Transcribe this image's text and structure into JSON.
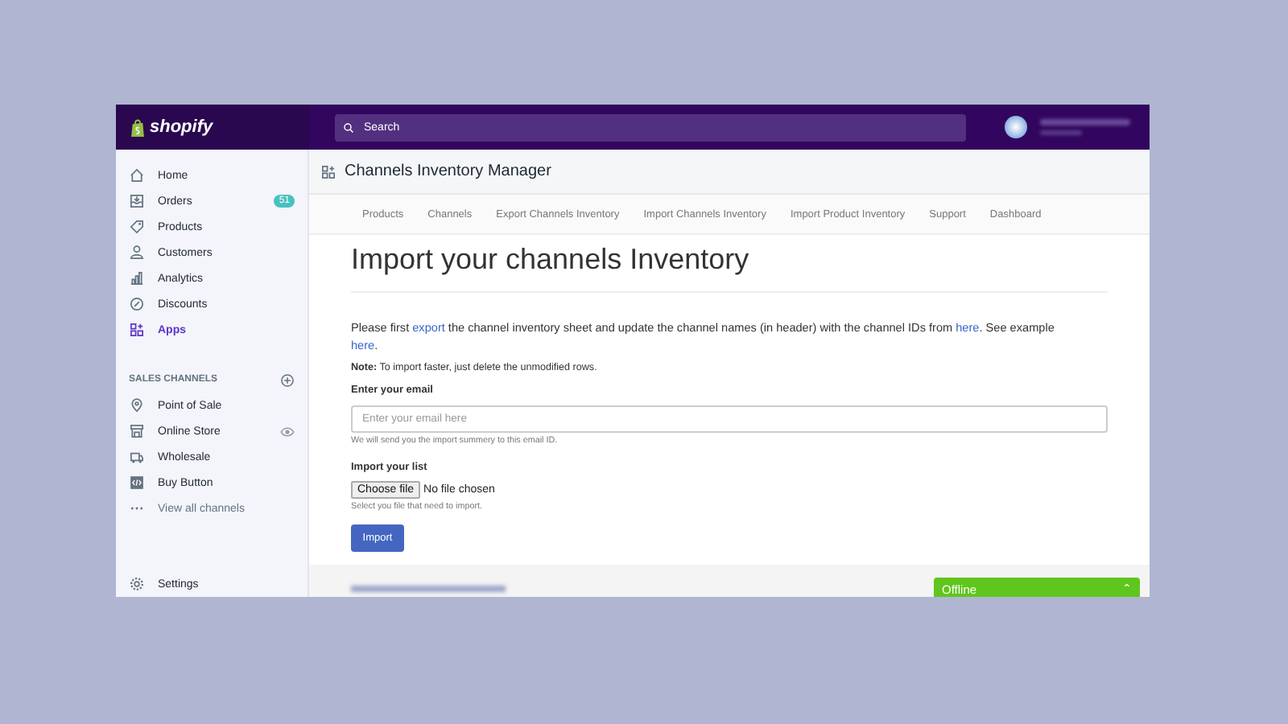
{
  "topbar": {
    "logo": "shopify",
    "search": {
      "placeholder": "Search"
    }
  },
  "sidebar": {
    "items": [
      {
        "label": "Home",
        "kind": "home",
        "selected": false
      },
      {
        "label": "Orders",
        "kind": "orders",
        "selected": false,
        "badge": "51"
      },
      {
        "label": "Products",
        "kind": "tag",
        "selected": false
      },
      {
        "label": "Customers",
        "kind": "person",
        "selected": false
      },
      {
        "label": "Analytics",
        "kind": "chart",
        "selected": false
      },
      {
        "label": "Discounts",
        "kind": "discount",
        "selected": false
      },
      {
        "label": "Apps",
        "kind": "apps",
        "selected": true
      }
    ],
    "section": {
      "title": "SALES CHANNELS",
      "items": [
        {
          "label": "Point of Sale",
          "kind": "pin",
          "selected": false
        },
        {
          "label": "Online Store",
          "kind": "store",
          "selected": false,
          "eye": true
        },
        {
          "label": "Wholesale",
          "kind": "truck",
          "selected": false
        },
        {
          "label": "Buy Button",
          "kind": "code",
          "selected": false
        },
        {
          "label": "View all channels",
          "kind": "dots",
          "selected": false,
          "muted": true
        }
      ]
    },
    "settings": {
      "label": "Settings",
      "kind": "gear"
    }
  },
  "app": {
    "title": "Channels Inventory Manager",
    "tabs": [
      {
        "label": "Products",
        "selected": false
      },
      {
        "label": "Channels",
        "selected": false
      },
      {
        "label": "Export Channels Inventory",
        "selected": false
      },
      {
        "label": "Import Channels Inventory",
        "selected": false
      },
      {
        "label": "Import Product Inventory",
        "selected": false
      },
      {
        "label": "Support",
        "selected": false
      },
      {
        "label": "Dashboard",
        "selected": false
      }
    ],
    "heading": "Import your channels Inventory",
    "intro": [
      {
        "kind": "text",
        "text": "Please first "
      },
      {
        "kind": "link",
        "text": "export"
      },
      {
        "kind": "text",
        "text": " the channel inventory sheet and update the channel names (in header) with the channel IDs from "
      },
      {
        "kind": "link",
        "text": "here"
      },
      {
        "kind": "text",
        "text": ". See example "
      },
      {
        "kind": "link",
        "text": "here"
      },
      {
        "kind": "text",
        "text": "."
      }
    ],
    "note": "**Note:** To import faster, just delete the unmodified rows.",
    "email": {
      "label": "Enter your email",
      "placeholder": "Enter your email here",
      "help": "We will send you the import summery to this email ID."
    },
    "file": {
      "label": "Import your list",
      "button": "Choose file",
      "status": "No file chosen",
      "help": "Select you file that need to import."
    },
    "submit": "Import"
  },
  "chat": {
    "label": "Offline",
    "caret": "⌃"
  }
}
